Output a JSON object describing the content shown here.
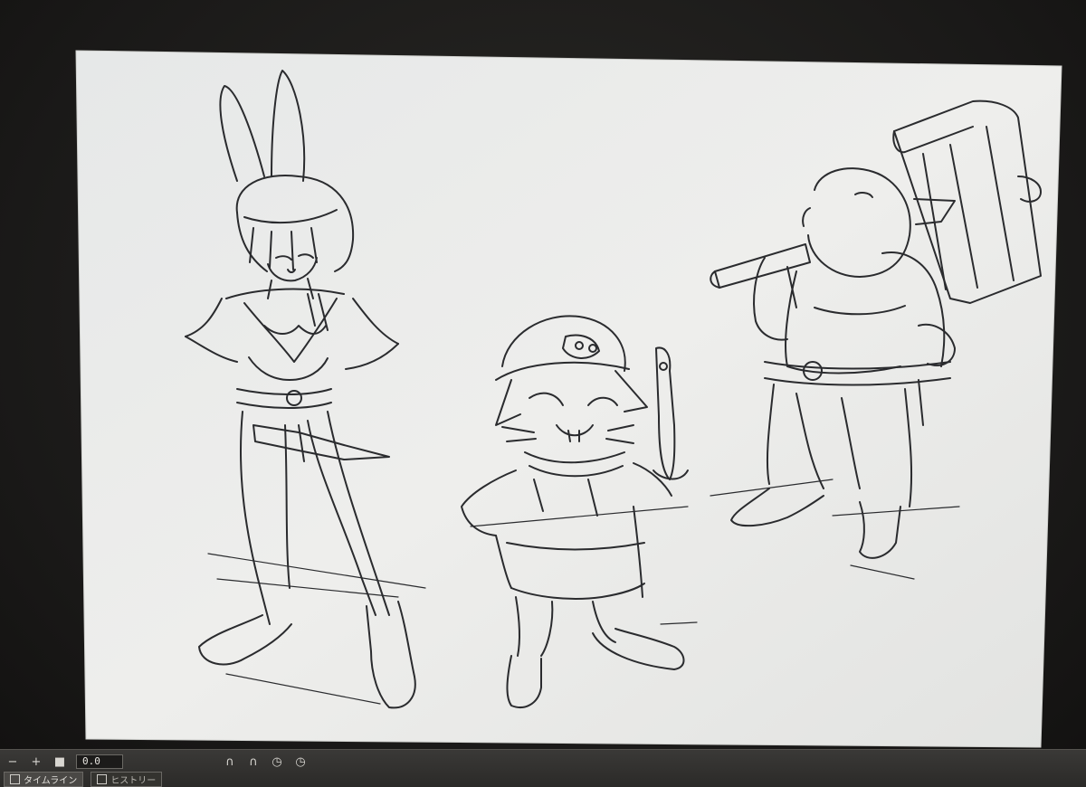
{
  "timeline": {
    "minus_label": "−",
    "plus_label": "+",
    "stop_label": "■",
    "frame_value": "0.0",
    "controls": [
      "∩",
      "∩",
      "◷",
      "◷"
    ]
  },
  "tabs": [
    {
      "label": "タイムライン",
      "icon": "timeline-icon"
    },
    {
      "label": "ヒストリー",
      "icon": "history-icon"
    }
  ],
  "colors": {
    "bezel": "#1f1e1c",
    "canvas_paper": "#ebeceb",
    "sketch_line": "#2a2b2e",
    "panel": "#3a3937"
  }
}
